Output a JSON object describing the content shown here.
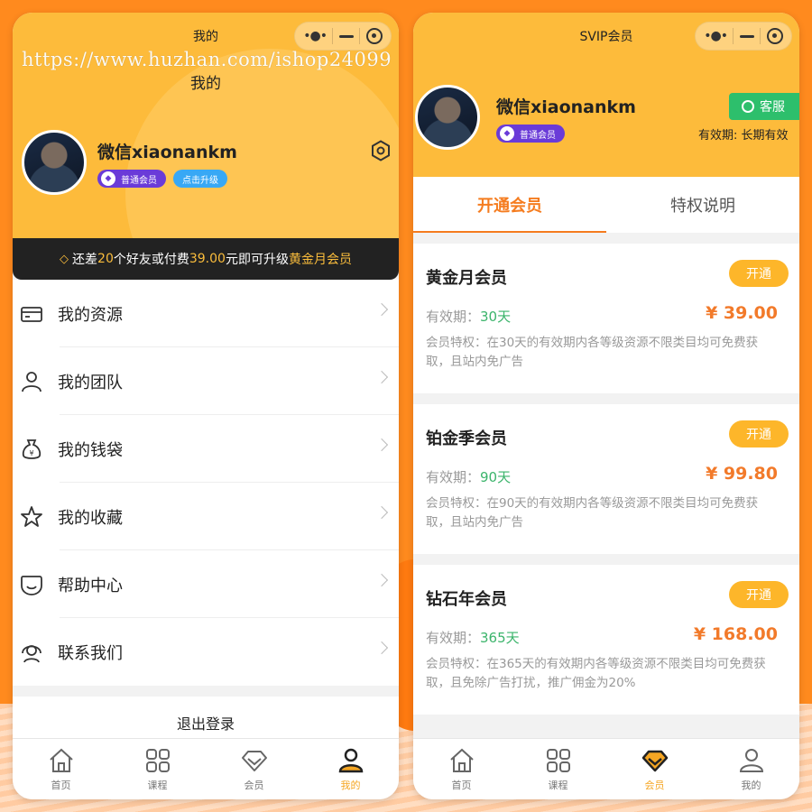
{
  "watermark": "https://www.huzhan.com/ishop24099",
  "colors": {
    "primary": "#fdbb3b",
    "accent": "#f57c1f",
    "green": "#2dbf6c",
    "vip": "#6a3bd8"
  },
  "left": {
    "nav_title": "我的",
    "subtitle": "我的",
    "username": "微信xiaonankm",
    "vip_badge": "普通会员",
    "upgrade_badge": "点击升级",
    "banner": {
      "pre": "还差",
      "count": "20",
      "mid": "个好友或付费",
      "amount": "39.00",
      "mid2": "元即可升级",
      "target": "黄金月会员"
    },
    "menu": [
      {
        "label": "我的资源",
        "icon": "card-icon"
      },
      {
        "label": "我的团队",
        "icon": "user-icon"
      },
      {
        "label": "我的钱袋",
        "icon": "money-bag-icon"
      },
      {
        "label": "我的收藏",
        "icon": "star-icon"
      },
      {
        "label": "帮助中心",
        "icon": "help-icon"
      },
      {
        "label": "联系我们",
        "icon": "headset-icon"
      }
    ],
    "logout": "退出登录"
  },
  "right": {
    "nav_title": "SVIP会员",
    "username": "微信xiaonankm",
    "vip_badge": "普通会员",
    "service": "客服",
    "validity": "有效期: 长期有效",
    "tabs": [
      "开通会员",
      "特权说明"
    ],
    "validity_label": "有效期：",
    "open_label": "开通",
    "plans": [
      {
        "name": "黄金月会员",
        "days": "30天",
        "price": "¥ 39.00",
        "desc": "会员特权：在30天的有效期内各等级资源不限类目均可免费获取，且站内免广告"
      },
      {
        "name": "铂金季会员",
        "days": "90天",
        "price": "¥ 99.80",
        "desc": "会员特权：在90天的有效期内各等级资源不限类目均可免费获取，且站内免广告"
      },
      {
        "name": "钻石年会员",
        "days": "365天",
        "price": "¥ 168.00",
        "desc": "会员特权：在365天的有效期内各等级资源不限类目均可免费获取，且免除广告打扰，推广佣金为20%"
      }
    ]
  },
  "tabbar": [
    "首页",
    "课程",
    "会员",
    "我的"
  ]
}
